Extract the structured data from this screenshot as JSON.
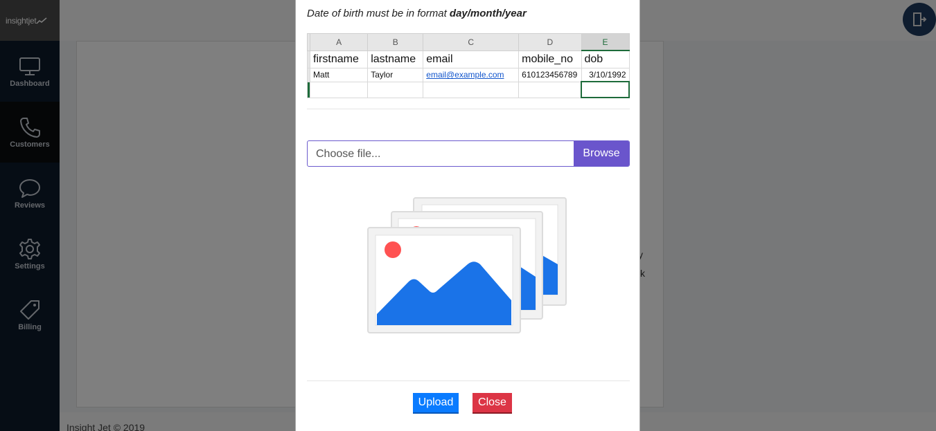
{
  "brand": {
    "name": "insightjet"
  },
  "sidebar": {
    "items": [
      {
        "label": "Dashboard",
        "icon": "monitor-icon"
      },
      {
        "label": "Customers",
        "icon": "phone-icon",
        "active": true
      },
      {
        "label": "Reviews",
        "icon": "chat-bubble-icon"
      },
      {
        "label": "Settings",
        "icon": "gear-icon"
      },
      {
        "label": "Billing",
        "icon": "tag-icon"
      }
    ]
  },
  "background": {
    "text1": "y",
    "text2": "k",
    "footer": "Insight Jet © 2019"
  },
  "modal": {
    "instruction_prefix": "Date of birth must be in format ",
    "instruction_format": "day/month/year",
    "sheet": {
      "columns": [
        "A",
        "B",
        "C",
        "D",
        "E"
      ],
      "headers": [
        "firstname",
        "lastname",
        "email",
        "mobile_no",
        "dob"
      ],
      "row": [
        "Matt",
        "Taylor",
        "email@example.com",
        "610123456789",
        "3/10/1992"
      ]
    },
    "file_input": {
      "placeholder": "Choose file...",
      "browse_label": "Browse"
    },
    "upload_label": "Upload",
    "close_label": "Close"
  },
  "colors": {
    "sidebar_bg": "#0c1a2b",
    "browse": "#6a55cc",
    "upload": "#0a7bff",
    "close": "#dc3545",
    "illustration_blue": "#1a73e8",
    "illustration_red": "#ff5252"
  }
}
